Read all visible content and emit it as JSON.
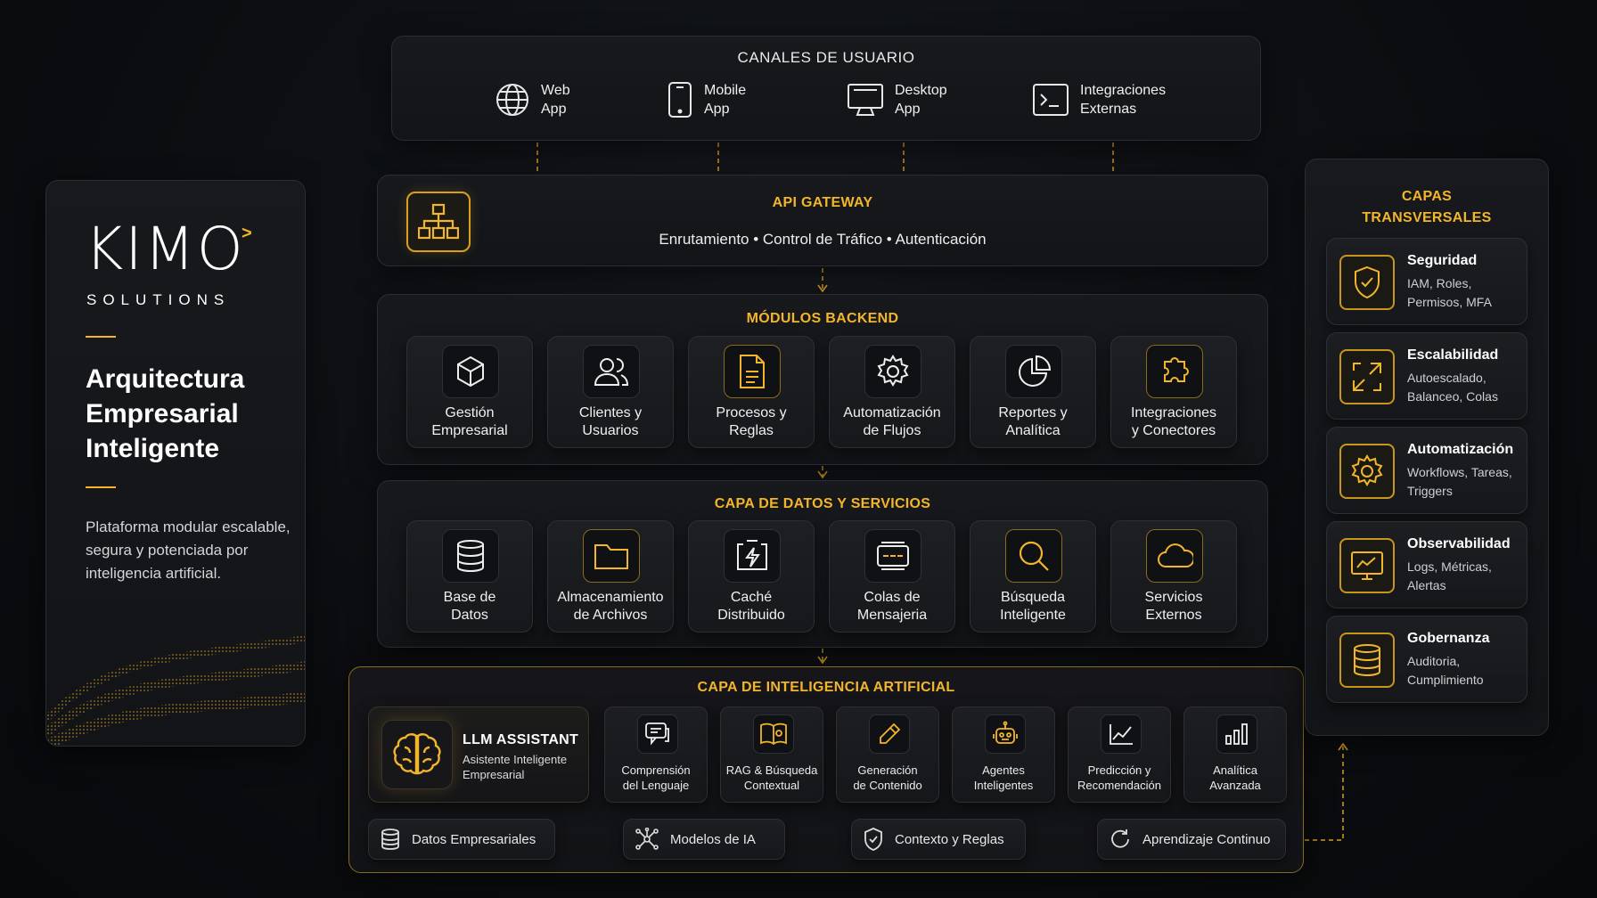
{
  "brand": {
    "logo": "KIMO",
    "logo_mark": ">",
    "logo_sub": "SOLUTIONS",
    "headline_1": "Arquitectura",
    "headline_2": "Empresarial",
    "headline_3": "Inteligente",
    "description": "Plataforma modular escalable, segura y potenciada por inteligencia artificial."
  },
  "channels": {
    "title": "CANALES DE USUARIO",
    "items": [
      {
        "line1": "Web",
        "line2": "App",
        "icon": "globe-icon"
      },
      {
        "line1": "Mobile",
        "line2": "App",
        "icon": "mobile-icon"
      },
      {
        "line1": "Desktop",
        "line2": "App",
        "icon": "desktop-icon"
      },
      {
        "line1": "Integraciones",
        "line2": "Externas",
        "icon": "terminal-icon"
      }
    ]
  },
  "gateway": {
    "title": "API GATEWAY",
    "subtitle": "Enrutamiento • Control de Tráfico • Autenticación",
    "icon": "hierarchy-icon"
  },
  "modules": {
    "title": "MÓDULOS BACKEND",
    "items": [
      {
        "line1": "Gestión",
        "line2": "Empresarial",
        "icon": "cube-icon"
      },
      {
        "line1": "Clientes y",
        "line2": "Usuarios",
        "icon": "users-icon"
      },
      {
        "line1": "Procesos y",
        "line2": "Reglas",
        "icon": "document-icon"
      },
      {
        "line1": "Automatización",
        "line2": "de Flujos",
        "icon": "gear-icon"
      },
      {
        "line1": "Reportes y",
        "line2": "Analítica",
        "icon": "pie-chart-icon"
      },
      {
        "line1": "Integraciones",
        "line2": "y Conectores",
        "icon": "puzzle-icon"
      }
    ]
  },
  "data_layer": {
    "title": "CAPA DE DATOS Y SERVICIOS",
    "items": [
      {
        "line1": "Base de",
        "line2": "Datos",
        "icon": "database-icon"
      },
      {
        "line1": "Almacenamiento",
        "line2": "de Archivos",
        "icon": "folder-icon"
      },
      {
        "line1": "Caché",
        "line2": "Distribuido",
        "icon": "cache-bolt-icon"
      },
      {
        "line1": "Colas de",
        "line2": "Mensajeria",
        "icon": "queue-icon"
      },
      {
        "line1": "Búsqueda",
        "line2": "Inteligente",
        "icon": "search-icon"
      },
      {
        "line1": "Servicios",
        "line2": "Externos",
        "icon": "cloud-icon"
      }
    ]
  },
  "ai_layer": {
    "title": "CAPA DE INTELIGENCIA ARTIFICIAL",
    "llm_title": "LLM ASSISTANT",
    "llm_sub_1": "Asistente Inteligente",
    "llm_sub_2": "Empresarial",
    "items": [
      {
        "line1": "Comprensión",
        "line2": "del Lenguaje",
        "icon": "chat-icon"
      },
      {
        "line1": "RAG & Búsqueda",
        "line2": "Contextual",
        "icon": "book-icon"
      },
      {
        "line1": "Generación",
        "line2": "de Contenido",
        "icon": "pencil-icon"
      },
      {
        "line1": "Agentes",
        "line2": "Inteligentes",
        "icon": "robot-icon"
      },
      {
        "line1": "Predicción y",
        "line2": "Recomendación",
        "icon": "line-chart-icon"
      },
      {
        "line1": "Analítica",
        "line2": "Avanzada",
        "icon": "bar-chart-icon"
      }
    ],
    "flow": [
      {
        "label": "Datos Empresariales",
        "icon": "database-icon"
      },
      {
        "label": "Modelos de IA",
        "icon": "network-icon"
      },
      {
        "label": "Contexto y Reglas",
        "icon": "shield-check-icon"
      },
      {
        "label": "Aprendizaje Continuo",
        "icon": "refresh-icon"
      }
    ]
  },
  "cross": {
    "title_1": "CAPAS",
    "title_2": "TRANSVERSALES",
    "items": [
      {
        "title": "Seguridad",
        "desc": "IAM, Roles, Permisos, MFA",
        "icon": "shield-icon"
      },
      {
        "title": "Escalabilidad",
        "desc": "Autoescalado, Balanceo, Colas",
        "icon": "expand-icon"
      },
      {
        "title": "Automatización",
        "desc": "Workflows, Tareas, Triggers",
        "icon": "gear-icon"
      },
      {
        "title": "Observabilidad",
        "desc": "Logs, Métricas, Alertas",
        "icon": "monitor-chart-icon"
      },
      {
        "title": "Gobernanza",
        "desc": "Auditoria, Cumplimiento",
        "icon": "database-icon"
      }
    ]
  },
  "colors": {
    "accent": "#f2b52c",
    "background": "#0b0d10",
    "panel": "#15171a"
  }
}
